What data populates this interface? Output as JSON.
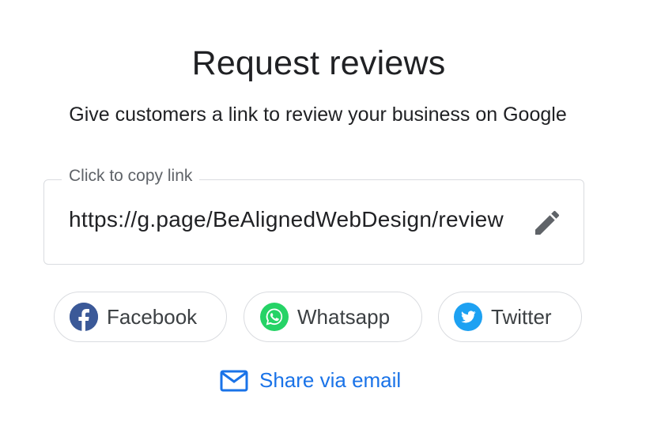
{
  "header": {
    "title": "Request reviews",
    "subtitle": "Give customers a link to review your business on Google"
  },
  "link_field": {
    "legend": "Click to copy link",
    "value": "https://g.page/BeAlignedWebDesign/review",
    "edit_icon": "pencil-icon"
  },
  "share": {
    "facebook_label": "Facebook",
    "whatsapp_label": "Whatsapp",
    "twitter_label": "Twitter",
    "email_label": "Share via email"
  },
  "colors": {
    "facebook": "#3b5998",
    "whatsapp": "#25d366",
    "twitter": "#1da1f2",
    "link_blue": "#1a73e8",
    "border": "#dadce0"
  }
}
